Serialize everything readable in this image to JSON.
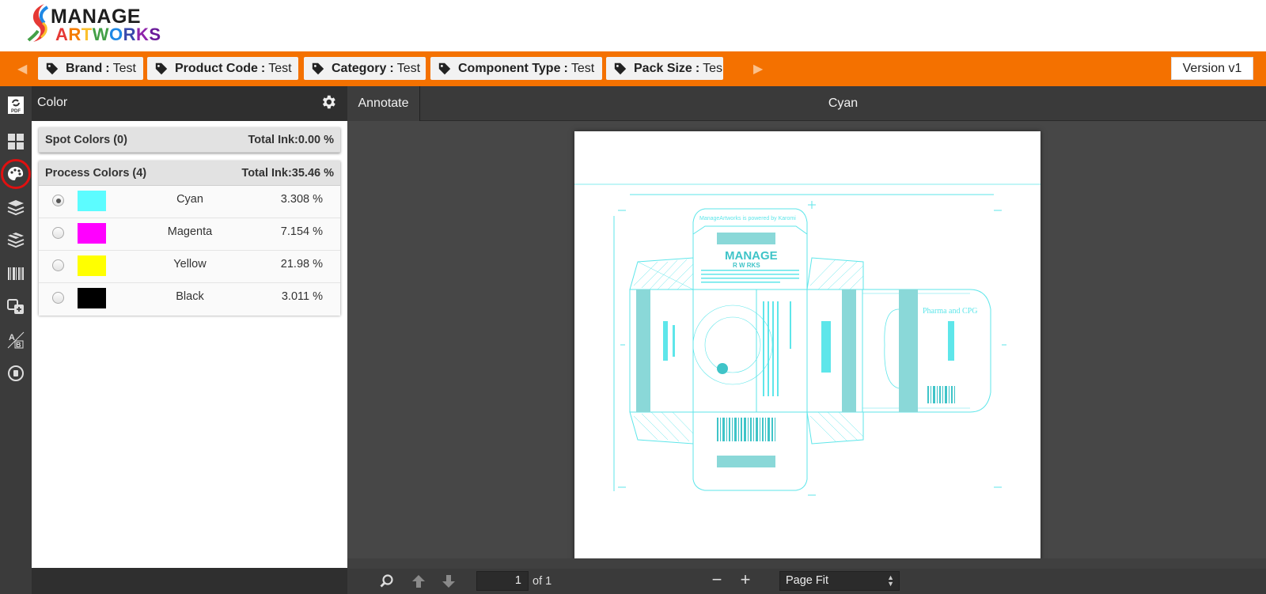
{
  "app": {
    "logo_top": "MANAGE",
    "logo_bottom": "ARTWORKS",
    "logo_colors": {
      "top": "#1e1e1e",
      "A": "#e53935",
      "R": "#f57c00",
      "T": "#fbc02d",
      "W": "#43a047",
      "O": "#1e88e5",
      "R2": "#3949ab",
      "K": "#8e24aa",
      "S": "#6a1b9a"
    }
  },
  "tagbar": {
    "accent": "#f47100",
    "left_arrow_icon": "triangle-left-icon",
    "right_arrow_icon": "triangle-right-icon",
    "tags": [
      {
        "key": "Brand",
        "sep": ":",
        "value": "Test"
      },
      {
        "key": "Product Code",
        "sep": ":",
        "value": "Test"
      },
      {
        "key": "Category",
        "sep": ":",
        "value": "Test"
      },
      {
        "key": "Component Type",
        "sep": ":",
        "value": "Test"
      },
      {
        "key": "Pack Size",
        "sep": ":",
        "value": "Tes"
      }
    ],
    "version_label": "Version v1"
  },
  "rail": {
    "items": [
      "pdf-refresh-icon",
      "grid-icon",
      "palette-icon",
      "layers-icon",
      "layers-alt-icon",
      "barcode-icon",
      "compare-icon",
      "text-compare-icon",
      "record-icon"
    ],
    "active": "palette-icon"
  },
  "panel": {
    "title": "Color",
    "settings_icon": "gear-icon",
    "spot": {
      "name": "Spot Colors (0)",
      "total": "Total Ink:0.00 %"
    },
    "process": {
      "name": "Process Colors (4)",
      "total": "Total Ink:35.46 %",
      "colors": [
        {
          "name": "Cyan",
          "pct": "3.308 %",
          "swatch": "#5cfcff",
          "selected": true
        },
        {
          "name": "Magenta",
          "pct": "7.154 %",
          "swatch": "#ff00ff",
          "selected": false
        },
        {
          "name": "Yellow",
          "pct": "21.98 %",
          "swatch": "#ffff00",
          "selected": false
        },
        {
          "name": "Black",
          "pct": "3.011 %",
          "swatch": "#000000",
          "selected": false
        }
      ]
    }
  },
  "viewer": {
    "annotate_label": "Annotate",
    "title": "Cyan",
    "ink_color": "#5ee6ea",
    "artwork": {
      "powered_by": "ManageArtworks is powered by Karomi",
      "brand_line": "MANAGE",
      "brand_sub": "R W RKS",
      "side_title": "Pharma and CPG"
    },
    "toolbar": {
      "search_icon": "search-icon",
      "prev_icon": "arrow-up-icon",
      "next_icon": "arrow-down-icon",
      "page_value": "1",
      "page_of": "of 1",
      "zoom_out": "−",
      "zoom_in": "+",
      "zoom_value": "Page Fit",
      "zoom_caret": "▲▼"
    }
  }
}
